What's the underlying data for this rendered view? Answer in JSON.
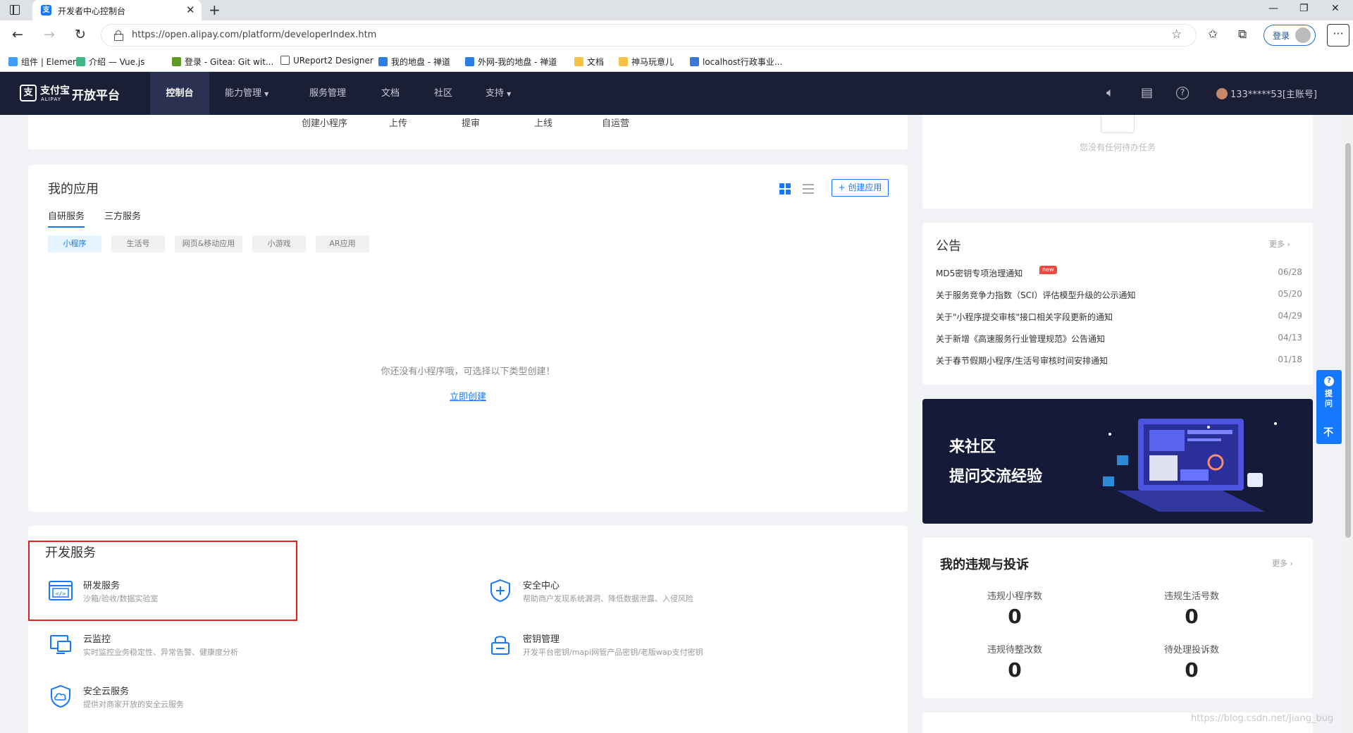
{
  "browser": {
    "tab_title": "开发者中心控制台",
    "url": "https://open.alipay.com/platform/developerIndex.htm",
    "login_label": "登录",
    "bookmarks": [
      {
        "label": "组件 | Element",
        "color": "#409eff"
      },
      {
        "label": "介绍 — Vue.js",
        "color": "#41b883"
      },
      {
        "label": "登录 - Gitea: Git wit...",
        "color": "#609926"
      },
      {
        "label": "UReport2 Designer",
        "color": "#ffffff"
      },
      {
        "label": "我的地盘 - 禅道",
        "color": "#2b7ee3"
      },
      {
        "label": "外网-我的地盘 - 禅道",
        "color": "#2b7ee3"
      },
      {
        "label": "文档",
        "color": "#f5c242"
      },
      {
        "label": "神马玩意儿",
        "color": "#f5c242"
      },
      {
        "label": "localhost行政事业...",
        "color": "#3a78d8"
      }
    ]
  },
  "header": {
    "logo_cn": "支付宝",
    "logo_en": "ALIPAY",
    "platform": "开放平台",
    "nav": [
      "控制台",
      "能力管理",
      "服务管理",
      "文档",
      "社区",
      "支持"
    ],
    "account": "133*****53[主账号]"
  },
  "steps": [
    "创建小程序",
    "上传",
    "提审",
    "上线",
    "自运营"
  ],
  "apps": {
    "title": "我的应用",
    "create_button": "+ 创建应用",
    "subtabs": [
      "自研服务",
      "三方服务"
    ],
    "chips": [
      "小程序",
      "生活号",
      "网页&移动应用",
      "小游戏",
      "AR应用"
    ],
    "empty_text": "你还没有小程序哦，可选择以下类型创建！",
    "create_link": "立即创建"
  },
  "dev_services": {
    "title": "开发服务",
    "items": [
      {
        "name": "研发服务",
        "desc": "沙箱/验收/数据实验室",
        "icon": "code-window-icon"
      },
      {
        "name": "安全中心",
        "desc": "帮助商户发现系统漏洞、降低数据泄露、入侵风险",
        "icon": "shield-plus-icon"
      },
      {
        "name": "云监控",
        "desc": "实时监控业务稳定性、异常告警、健康度分析",
        "icon": "monitor-icon"
      },
      {
        "name": "密钥管理",
        "desc": "开发平台密钥/mapi网管产品密钥/老版wap支付密钥",
        "icon": "lock-icon"
      },
      {
        "name": "安全云服务",
        "desc": "提供对商家开放的安全云服务",
        "icon": "shield-cloud-icon"
      }
    ]
  },
  "todo": {
    "empty_text": "您没有任何待办任务"
  },
  "notices": {
    "title": "公告",
    "more": "更多",
    "new_badge": "new",
    "items": [
      {
        "text": "MD5密钥专项治理通知",
        "date": "06/28"
      },
      {
        "text": "关于服务竞争力指数（SCI）评估模型升级的公示通知",
        "date": "05/20"
      },
      {
        "text": "关于\"小程序提交审核\"接口相关字段更新的通知",
        "date": "04/29"
      },
      {
        "text": "关于新增《高速服务行业管理规范》公告通知",
        "date": "04/13"
      },
      {
        "text": "关于春节假期小程序/生活号审核时间安排通知",
        "date": "01/18"
      }
    ]
  },
  "community": {
    "line1": "来社区",
    "line2": "提问交流经验"
  },
  "violations": {
    "title": "我的违规与投诉",
    "more": "更多",
    "stats": [
      {
        "label": "违规小程序数",
        "value": "0"
      },
      {
        "label": "违规生活号数",
        "value": "0"
      },
      {
        "label": "违规待整改数",
        "value": "0"
      },
      {
        "label": "待处理投诉数",
        "value": "0"
      }
    ]
  },
  "float_help": {
    "label": "提问",
    "top": "不"
  },
  "watermark": "https://blog.csdn.net/Jiang_bug",
  "colors": {
    "brand": "#1677ff",
    "header_bg": "#1a1f35",
    "highlight": "#e02020"
  }
}
